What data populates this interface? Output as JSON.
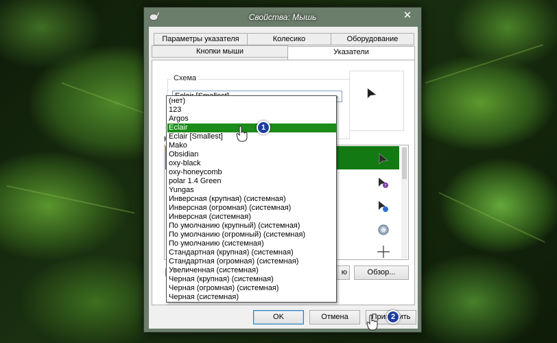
{
  "window": {
    "title": "Свойства: Мышь",
    "close_glyph": "✕"
  },
  "tabs": {
    "row1": [
      "Параметры указателя",
      "Колесико",
      "Оборудование"
    ],
    "row2": [
      "Кнопки мыши",
      "Указатели"
    ],
    "active": "Указатели"
  },
  "scheme": {
    "legend": "Схема",
    "selected": "Eclair [Smallest]",
    "options": [
      "(нет)",
      "123",
      "Argos",
      "Eclair",
      "Eclair [Smallest]",
      "Mako",
      "Obsidian",
      "oxy-black",
      "oxy-honeycomb",
      "polar 1.4 Green",
      "Yungas",
      "Инверсная (крупная) (системная)",
      "Инверсная (огромная) (системная)",
      "Инверсная (системная)",
      "По умолчанию (крупный) (системная)",
      "По умолчанию (огромный) (системная)",
      "По умолчанию (системная)",
      "Стандартная (крупная) (системная)",
      "Стандартная (огромная) (системная)",
      "Увеличенная (системная)",
      "Черная (крупная) (системная)",
      "Черная (огромная) (системная)",
      "Черная (системная)"
    ],
    "highlighted": "Eclair"
  },
  "list": {
    "label_partial": "Н"
  },
  "buttons": {
    "default_partial": "ю",
    "browse": "Обзор...",
    "ok": "OK",
    "cancel": "Отмена",
    "apply": "Применить"
  },
  "callouts": {
    "step1": "1",
    "step2": "2"
  },
  "colors": {
    "selection_green": "#1b8c19",
    "callout_blue": "#1f3d9e"
  }
}
